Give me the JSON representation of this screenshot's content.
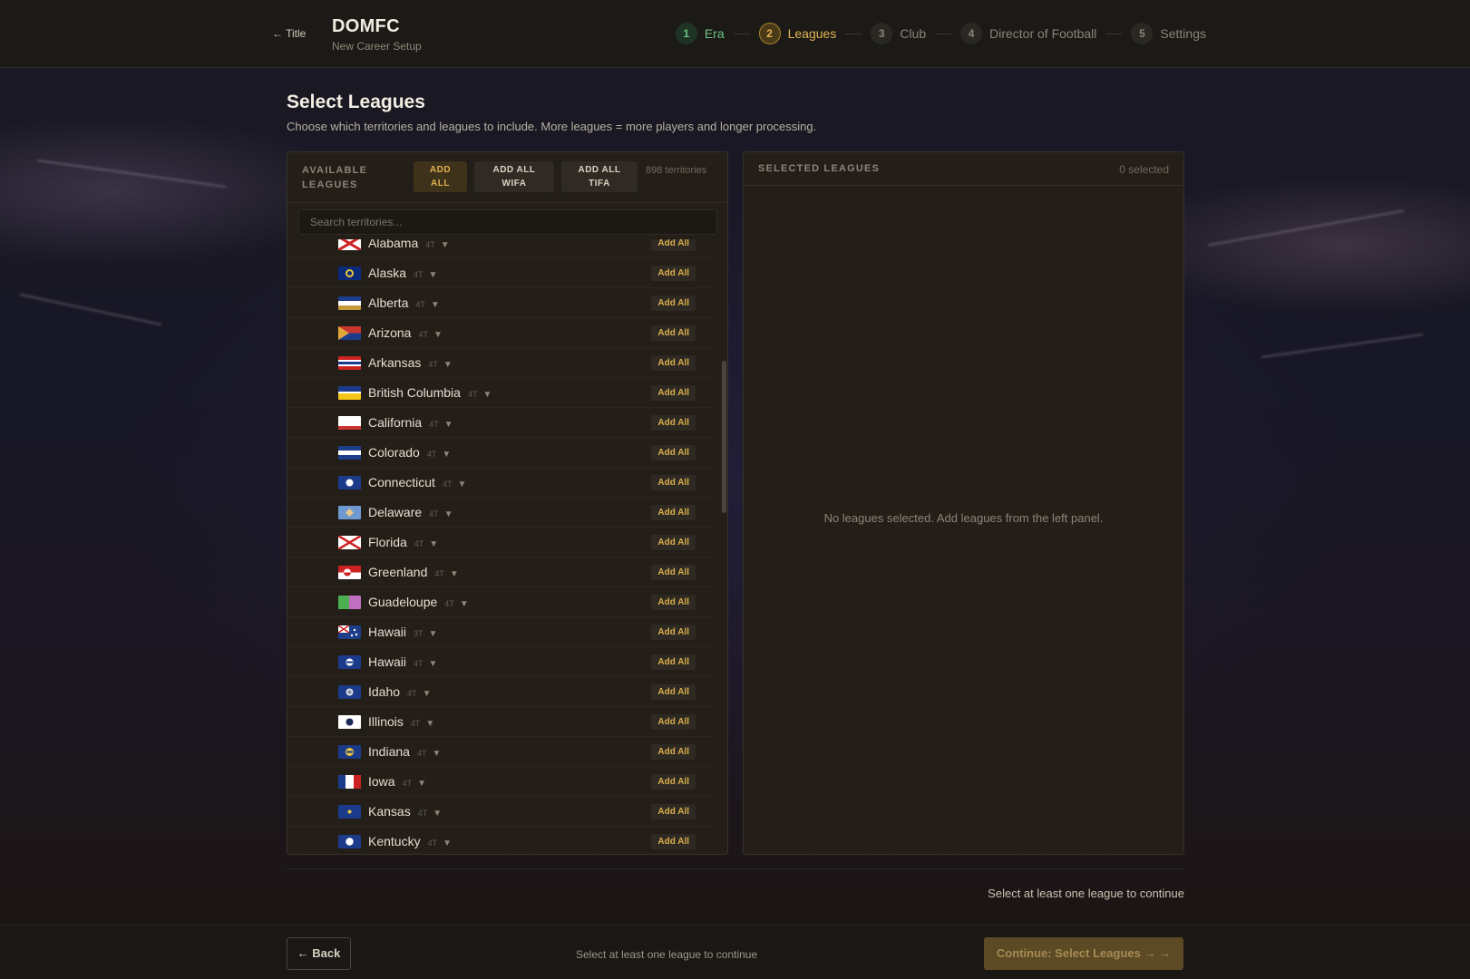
{
  "header": {
    "back_label": "← Title",
    "brand": "DOMFC",
    "subtitle": "New Career Setup",
    "steps": [
      {
        "num": "1",
        "label": "Era"
      },
      {
        "num": "2",
        "label": "Leagues"
      },
      {
        "num": "3",
        "label": "Club"
      },
      {
        "num": "4",
        "label": "Director of Football"
      },
      {
        "num": "5",
        "label": "Settings"
      }
    ]
  },
  "page": {
    "title": "Select Leagues",
    "subtitle": "Choose which territories and leagues to include. More leagues = more players and longer processing."
  },
  "available": {
    "title": "AVAILABLE LEAGUES",
    "add_all": "ADD ALL",
    "add_all_wifa": "ADD ALL WIFA",
    "add_all_tifa": "ADD ALL TIFA",
    "territory_count": "898 territories",
    "search_placeholder": "Search territories...",
    "row_button": "Add All",
    "territories": [
      {
        "name": "Alabama",
        "tiers": "4T",
        "flag": "alabama"
      },
      {
        "name": "Alaska",
        "tiers": "4T",
        "flag": "alaska"
      },
      {
        "name": "Alberta",
        "tiers": "4T",
        "flag": "alberta"
      },
      {
        "name": "Arizona",
        "tiers": "4T",
        "flag": "arizona"
      },
      {
        "name": "Arkansas",
        "tiers": "4T",
        "flag": "arkansas"
      },
      {
        "name": "British Columbia",
        "tiers": "4T",
        "flag": "bc"
      },
      {
        "name": "California",
        "tiers": "4T",
        "flag": "california"
      },
      {
        "name": "Colorado",
        "tiers": "4T",
        "flag": "colorado"
      },
      {
        "name": "Connecticut",
        "tiers": "4T",
        "flag": "connecticut"
      },
      {
        "name": "Delaware",
        "tiers": "4T",
        "flag": "delaware"
      },
      {
        "name": "Florida",
        "tiers": "4T",
        "flag": "florida"
      },
      {
        "name": "Greenland",
        "tiers": "4T",
        "flag": "greenland"
      },
      {
        "name": "Guadeloupe",
        "tiers": "4T",
        "flag": "guadeloupe"
      },
      {
        "name": "Hawaii",
        "tiers": "3T",
        "flag": "hawaii1"
      },
      {
        "name": "Hawaii",
        "tiers": "4T",
        "flag": "hawaii2"
      },
      {
        "name": "Idaho",
        "tiers": "4T",
        "flag": "idaho"
      },
      {
        "name": "Illinois",
        "tiers": "4T",
        "flag": "illinois"
      },
      {
        "name": "Indiana",
        "tiers": "4T",
        "flag": "indiana"
      },
      {
        "name": "Iowa",
        "tiers": "4T",
        "flag": "iowa"
      },
      {
        "name": "Kansas",
        "tiers": "4T",
        "flag": "kansas"
      },
      {
        "name": "Kentucky",
        "tiers": "4T",
        "flag": "kentucky"
      }
    ]
  },
  "selected": {
    "title": "SELECTED LEAGUES",
    "count": "0 selected",
    "empty": "No leagues selected. Add leagues from the left panel."
  },
  "status_text": "Select at least one league to continue",
  "footer": {
    "back": "← Back",
    "hint": "Select at least one league to continue",
    "continue": "Continue: Select Leagues → →"
  },
  "colors": {
    "accent": "#e3b451",
    "done": "#6fc27e",
    "panel": "#231f18"
  }
}
